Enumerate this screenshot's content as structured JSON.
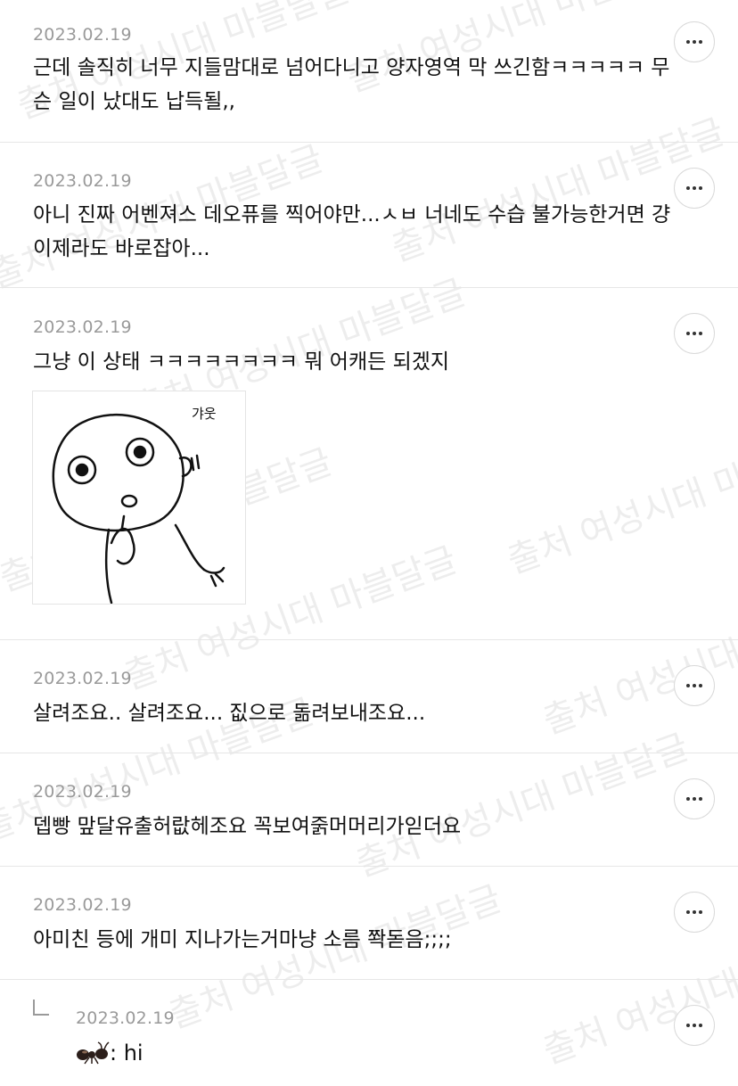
{
  "comments": [
    {
      "date": "2023.02.19",
      "text": "근데 솔직히 너무 지들맘대로 넘어다니고 양자영역 막 쓰긴함ㅋㅋㅋㅋㅋ 무슨 일이 났대도 납득될,,"
    },
    {
      "date": "2023.02.19",
      "text": "아니 진짜 어벤져스 데오퓨를 찍어야만...ㅅㅂ 너네도 수습 불가능한거면 걍 이제라도 바로잡아..."
    },
    {
      "date": "2023.02.19",
      "text": "그냥 이 상태 ㅋㅋㅋㅋㅋㅋㅋㅋ 뭐 어캐든 되겠지",
      "sticker_caption": "갸웃"
    },
    {
      "date": "2023.02.19",
      "text": "살려조요.. 살려조요... 짒으로 돎려보내조요..."
    },
    {
      "date": "2023.02.19",
      "text": "뎁빵 맢달유출허랎헤조요 꼭보여줅머머리가읻더요"
    },
    {
      "date": "2023.02.19",
      "text": "아미친 등에 개미 지나가는거마냥 소름 쫙돋음;;;;"
    }
  ],
  "reply": {
    "date": "2023.02.19",
    "text": ": hi",
    "icon": "ant-icon"
  },
  "watermark": "출처 여성시대 마블달글",
  "more_icon": "more-dots-icon",
  "reply_icon": "reply-arrow-icon"
}
